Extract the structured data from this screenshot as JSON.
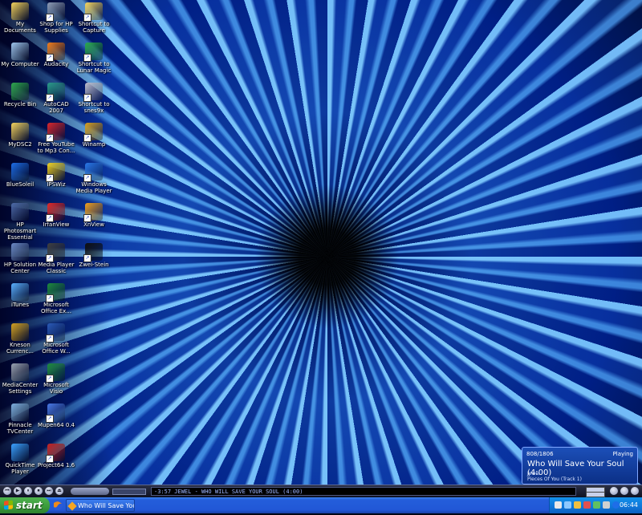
{
  "desktop_icons": [
    {
      "label": "My Documents",
      "icon": "folder-documents-icon",
      "color": "#f4d35e"
    },
    {
      "label": "My Computer",
      "icon": "computer-icon",
      "color": "#9fc7f0"
    },
    {
      "label": "Recycle Bin",
      "icon": "recycle-bin-icon",
      "color": "#2fa84f"
    },
    {
      "label": "MyDSC2",
      "icon": "folder-icon",
      "color": "#f4d35e"
    },
    {
      "label": "BlueSoleil",
      "icon": "bluetooth-icon",
      "color": "#1e6ee8"
    },
    {
      "label": "HP Photosmart Essential",
      "icon": "hp-photosmart-icon",
      "color": "#4d6aa8"
    },
    {
      "label": "HP Solution Center",
      "icon": "hp-solution-center-icon",
      "color": "#6d8bc8"
    },
    {
      "label": "iTunes",
      "icon": "itunes-icon",
      "color": "#5ab0ff"
    },
    {
      "label": "Kneson Currenc...",
      "icon": "currency-converter-icon",
      "color": "#d4a020"
    },
    {
      "label": "MediaCenter Settings",
      "icon": "mediacenter-settings-icon",
      "color": "#9aa3b2"
    },
    {
      "label": "Pinnacle TVCenter",
      "icon": "pinnacle-tvcenter-icon",
      "color": "#7fb0e0"
    },
    {
      "label": "QuickTime Player",
      "icon": "quicktime-icon",
      "color": "#3aa0ff"
    },
    {
      "label": "Shop for HP Supplies",
      "icon": "hp-supplies-icon",
      "color": "#8e9db8"
    },
    {
      "label": "Audacity",
      "icon": "audacity-icon",
      "color": "#f07a1a"
    },
    {
      "label": "AutoCAD 2007",
      "icon": "autocad-icon",
      "color": "#2a9a8a"
    },
    {
      "label": "Free YouTube to Mp3 Con...",
      "icon": "youtube-mp3-icon",
      "color": "#d8282e"
    },
    {
      "label": "IPSWiz",
      "icon": "radiation-icon",
      "color": "#f0d020"
    },
    {
      "label": "IrfanView",
      "icon": "irfanview-icon",
      "color": "#e02828"
    },
    {
      "label": "Media Player Classic",
      "icon": "media-player-classic-icon",
      "color": "#404040"
    },
    {
      "label": "Microsoft Office Ex...",
      "icon": "excel-icon",
      "color": "#1e8a3e"
    },
    {
      "label": "Microsoft Office W...",
      "icon": "word-icon",
      "color": "#2a5ab8"
    },
    {
      "label": "Microsoft Visio",
      "icon": "visio-icon",
      "color": "#1e8a3e"
    },
    {
      "label": "Mupen64 0.4",
      "icon": "mupen64-icon",
      "color": "#4a7ae8"
    },
    {
      "label": "Project64 1.6",
      "icon": "project64-icon",
      "color": "#c82828"
    },
    {
      "label": "Shortcut to Capture",
      "icon": "folder-shortcut-icon",
      "color": "#f4d35e"
    },
    {
      "label": "Shortcut to Lunar Magic",
      "icon": "lunar-magic-icon",
      "color": "#2aa84a"
    },
    {
      "label": "Shortcut to snes9x",
      "icon": "snes9x-icon",
      "color": "#c0c0d0"
    },
    {
      "label": "Winamp",
      "icon": "winamp-icon",
      "color": "#d8a020"
    },
    {
      "label": "Windows Media Player",
      "icon": "windows-media-player-icon",
      "color": "#2a78e8"
    },
    {
      "label": "XnView",
      "icon": "xnview-icon",
      "color": "#f0a020"
    },
    {
      "label": "Zwei-Stein",
      "icon": "zwei-stein-icon",
      "color": "#101010"
    }
  ],
  "now_playing": {
    "counter": "808/1806",
    "status": "Playing",
    "title": "Who Will Save Your Soul (4:00)",
    "artist": "Jewel",
    "album": "Pieces Of You (Track 1)"
  },
  "winamp_bar": {
    "ticker": "-3:57  JEWEL - WHO WILL SAVE YOUR SOUL (4:00)",
    "buttons": [
      "⏮",
      "▶",
      "⏸",
      "⏹",
      "⏭",
      "⏏"
    ]
  },
  "taskbar": {
    "start_label": "start",
    "task_label": "Who Will Save Your ...",
    "clock": "06:44",
    "accent": "#245edb"
  }
}
